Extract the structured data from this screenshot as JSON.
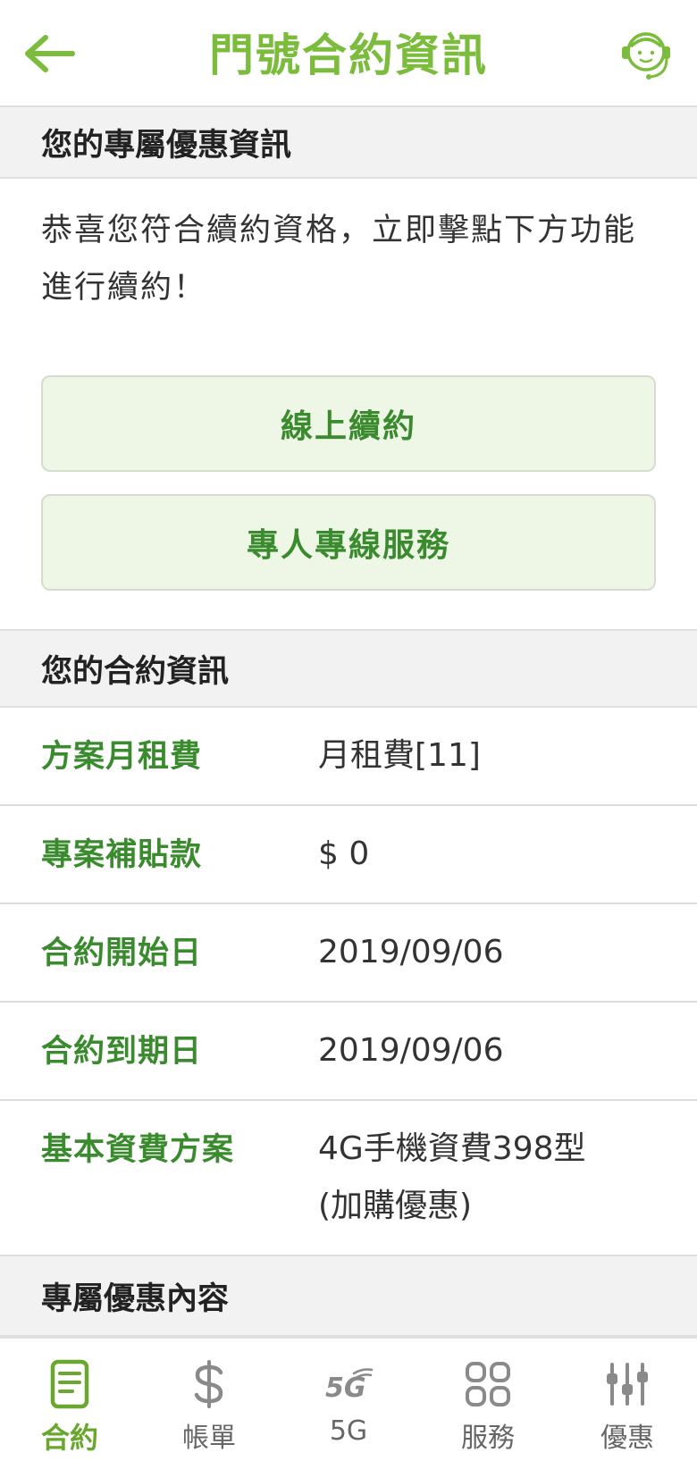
{
  "header": {
    "title": "門號合約資訊",
    "back_icon": "back-arrow-icon",
    "support_icon": "customer-service-icon",
    "accent_color": "#7cbc3c"
  },
  "promo_section": {
    "heading": "您的專屬優惠資訊",
    "message": "恭喜您符合續約資格，立即擊點下方功能進行續約！",
    "buttons": [
      {
        "label": "線上續約"
      },
      {
        "label": "專人專線服務"
      }
    ]
  },
  "contract_section": {
    "heading": "您的合約資訊",
    "rows": [
      {
        "label": "方案月租費",
        "value": "月租費[11]"
      },
      {
        "label": "專案補貼款",
        "value": "$ 0"
      },
      {
        "label": "合約開始日",
        "value": "2019/09/06"
      },
      {
        "label": "合約到期日",
        "value": "2019/09/06"
      },
      {
        "label": "基本資費方案",
        "value": "4G手機資費398型\n(加購優惠)",
        "value_line1": "4G手機資費398型",
        "value_line2": "(加購優惠)"
      }
    ]
  },
  "offer_section": {
    "heading": "專屬優惠內容"
  },
  "bottom_nav": {
    "active_index": 0,
    "items": [
      {
        "label": "合約",
        "icon": "contract-document-icon"
      },
      {
        "label": "帳單",
        "icon": "dollar-icon"
      },
      {
        "label": "5G",
        "icon": "5g-icon"
      },
      {
        "label": "服務",
        "icon": "services-grid-icon"
      },
      {
        "label": "優惠",
        "icon": "sliders-icon"
      }
    ]
  }
}
